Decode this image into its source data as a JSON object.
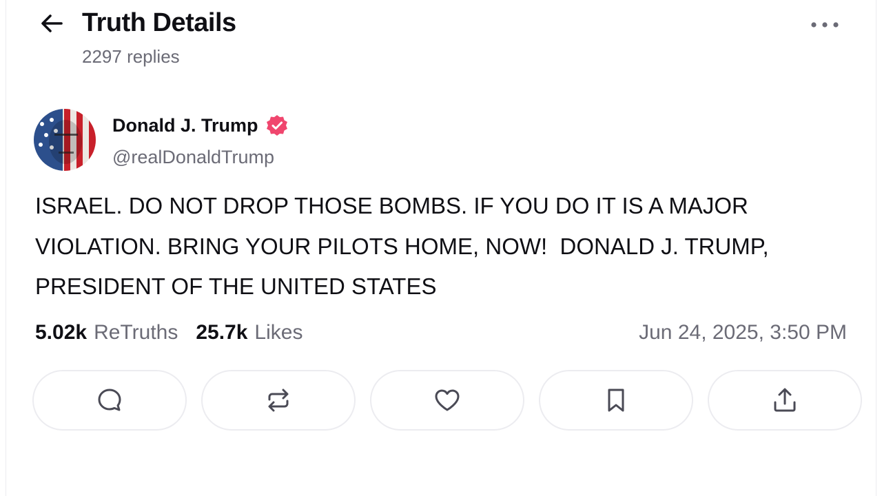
{
  "header": {
    "title": "Truth Details",
    "reply_count": "2297 replies",
    "back_icon": "arrow-left-icon",
    "more_icon": "ellipsis-icon"
  },
  "post": {
    "author_name": "Donald J. Trump",
    "handle": "@realDonaldTrump",
    "verified": true,
    "verified_color": "#f0466e",
    "text": "ISRAEL. DO NOT DROP THOSE BOMBS. IF YOU DO IT IS A MAJOR VIOLATION. BRING YOUR PILOTS HOME, NOW!  DONALD J. TRUMP, PRESIDENT OF THE UNITED STATES",
    "retruths_count": "5.02k",
    "retruths_label": "ReTruths",
    "likes_count": "25.7k",
    "likes_label": "Likes",
    "timestamp": "Jun 24, 2025, 3:50 PM"
  },
  "actions": [
    {
      "name": "reply",
      "icon": "comment-icon"
    },
    {
      "name": "retruth",
      "icon": "repost-icon"
    },
    {
      "name": "like",
      "icon": "heart-icon"
    },
    {
      "name": "bookmark",
      "icon": "bookmark-icon"
    },
    {
      "name": "share",
      "icon": "share-icon"
    }
  ]
}
